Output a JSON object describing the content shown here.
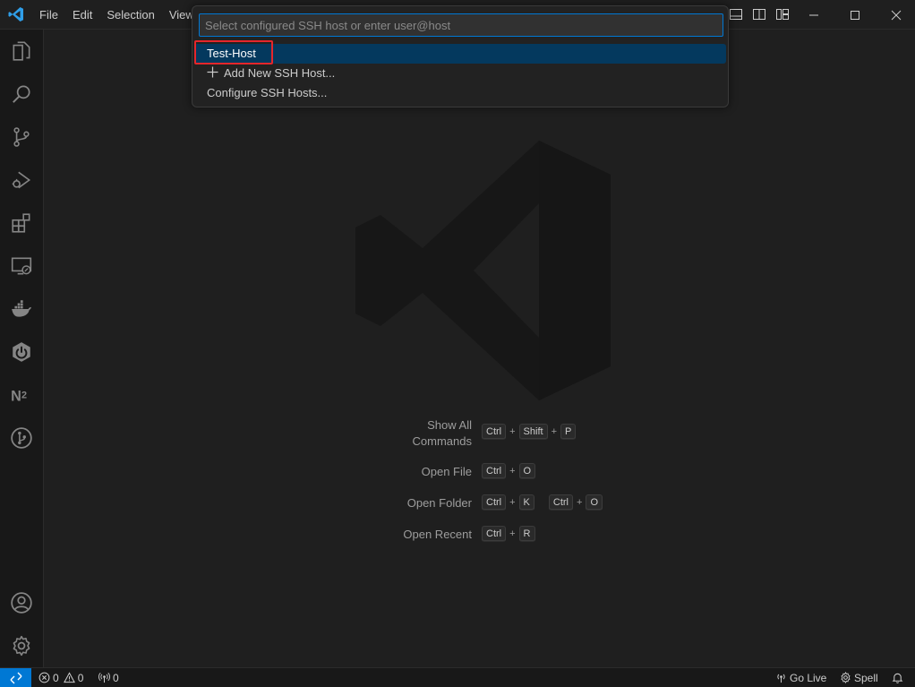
{
  "menu": {
    "file": "File",
    "edit": "Edit",
    "selection": "Selection",
    "view": "View"
  },
  "quick_pick": {
    "placeholder": "Select configured SSH host or enter user@host",
    "items": [
      {
        "label": "Test-Host",
        "selected": true
      },
      {
        "label": "Add New SSH Host...",
        "icon": "plus-icon"
      },
      {
        "label": "Configure SSH Hosts..."
      }
    ]
  },
  "activity_bar": [
    "explorer-icon",
    "search-icon",
    "source-control-icon",
    "run-debug-icon",
    "extensions-icon",
    "remote-explorer-icon",
    "docker-icon",
    "spring-boot-icon",
    "notebook-icon",
    "git-graph-icon",
    "accounts-icon",
    "manage-gear-icon"
  ],
  "shortcuts": [
    {
      "label_line1": "Show All",
      "label_line2": "Commands",
      "keys": [
        [
          "Ctrl",
          "Shift",
          "P"
        ]
      ]
    },
    {
      "label": "Open File",
      "keys": [
        [
          "Ctrl",
          "O"
        ]
      ]
    },
    {
      "label": "Open Folder",
      "keys": [
        [
          "Ctrl",
          "K"
        ],
        [
          "Ctrl",
          "O"
        ]
      ]
    },
    {
      "label": "Open Recent",
      "keys": [
        [
          "Ctrl",
          "R"
        ]
      ]
    }
  ],
  "status_bar": {
    "errors": "0",
    "warnings": "0",
    "ports": "0",
    "go_live": "Go Live",
    "spell": "Spell"
  },
  "colors": {
    "accent": "#0078d4",
    "selection": "#04395e",
    "highlight_box": "#e5262b",
    "background": "#1f1f1f"
  }
}
